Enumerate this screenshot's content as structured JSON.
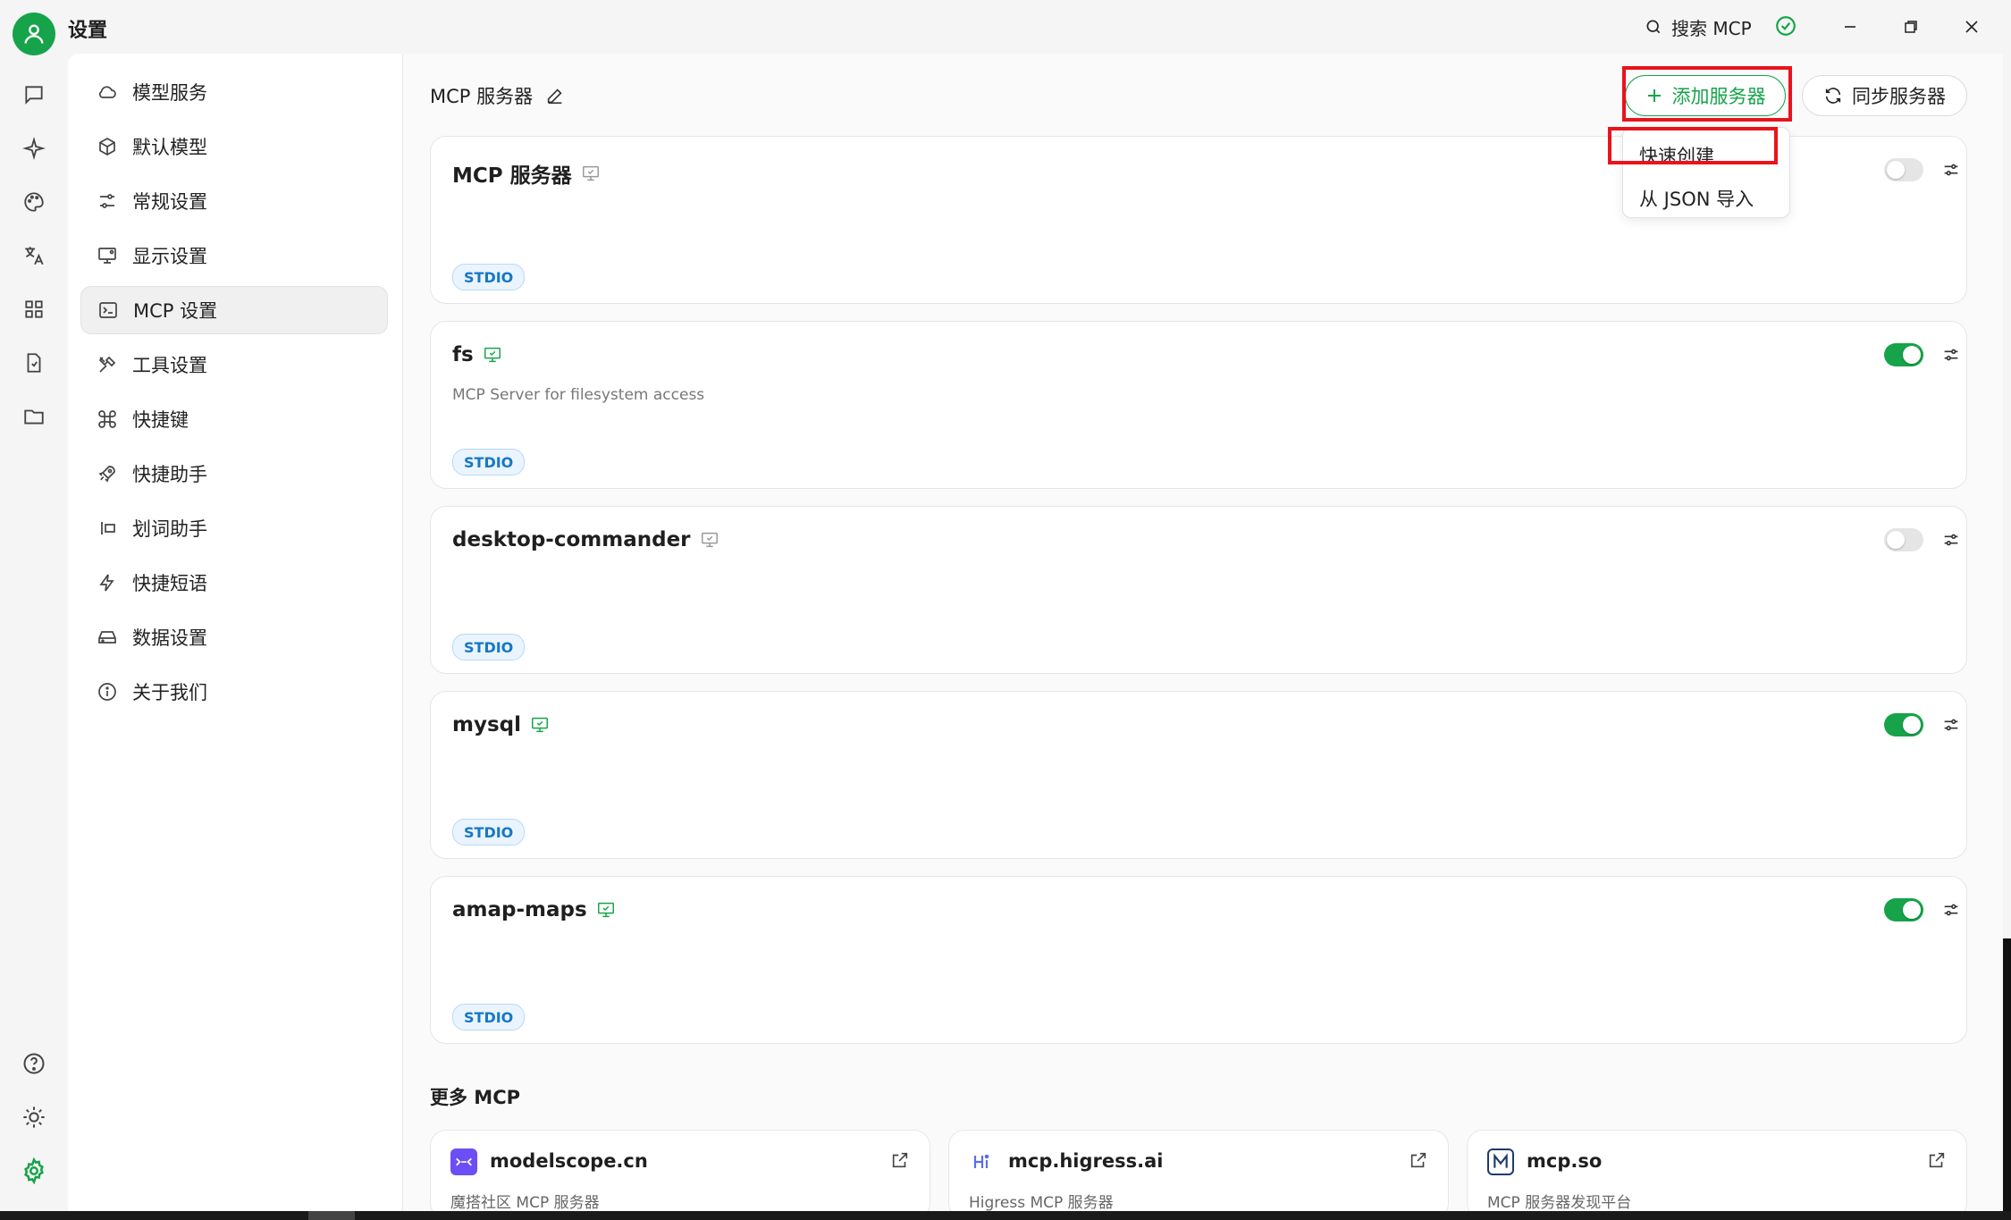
{
  "app": {
    "title": "设置"
  },
  "header": {
    "search_label": "搜索 MCP"
  },
  "nav": {
    "items": [
      {
        "label": "模型服务",
        "icon": "cloud-icon"
      },
      {
        "label": "默认模型",
        "icon": "cube-icon"
      },
      {
        "label": "常规设置",
        "icon": "sliders-icon"
      },
      {
        "label": "显示设置",
        "icon": "monitor-icon"
      },
      {
        "label": "MCP 设置",
        "icon": "terminal-icon",
        "active": true
      },
      {
        "label": "工具设置",
        "icon": "tools-icon"
      },
      {
        "label": "快捷键",
        "icon": "command-icon"
      },
      {
        "label": "快捷助手",
        "icon": "rocket-icon"
      },
      {
        "label": "划词助手",
        "icon": "text-select-icon"
      },
      {
        "label": "快捷短语",
        "icon": "zap-icon"
      },
      {
        "label": "数据设置",
        "icon": "hard-drive-icon"
      },
      {
        "label": "关于我们",
        "icon": "info-icon"
      }
    ]
  },
  "main": {
    "section_title": "MCP 服务器",
    "add_button": "添加服务器",
    "sync_button": "同步服务器",
    "dropdown": {
      "quick_create": "快速创建",
      "import_json": "从 JSON 导入"
    },
    "servers": [
      {
        "name": "MCP 服务器",
        "description": "",
        "type": "STDIO",
        "enabled": false
      },
      {
        "name": "fs",
        "description": "MCP Server for filesystem access",
        "type": "STDIO",
        "enabled": true
      },
      {
        "name": "desktop-commander",
        "description": "",
        "type": "STDIO",
        "enabled": false
      },
      {
        "name": "mysql",
        "description": "",
        "type": "STDIO",
        "enabled": true
      },
      {
        "name": "amap-maps",
        "description": "",
        "type": "STDIO",
        "enabled": true
      }
    ],
    "more_title": "更多 MCP",
    "more": [
      {
        "name": "modelscope.cn",
        "description": "魔搭社区 MCP 服务器",
        "logo_color": "#6b4ef5"
      },
      {
        "name": "mcp.higress.ai",
        "description": "Higress MCP 服务器",
        "logo_color": "#5a6ee8"
      },
      {
        "name": "mcp.so",
        "description": "MCP 服务器发现平台",
        "logo_color": "#1e3a6e"
      }
    ]
  },
  "colors": {
    "accent": "#16a34a",
    "highlight": "#e8141c",
    "badge": "#1677c7"
  }
}
